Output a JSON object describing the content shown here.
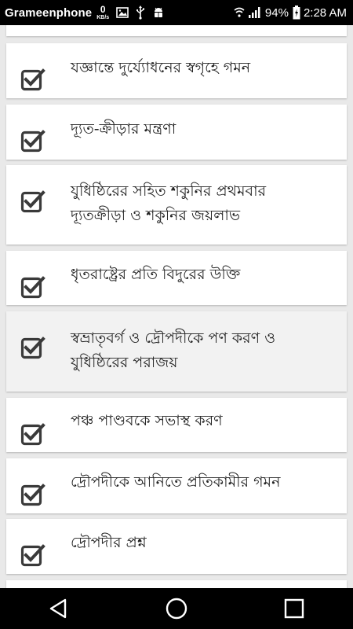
{
  "status_bar": {
    "carrier": "Grameenphone",
    "net_speed_value": "0",
    "net_speed_unit": "KB/s",
    "battery": "94%",
    "time": "2:28 AM"
  },
  "icons": {
    "image": "image-icon",
    "usb": "usb-icon",
    "debug": "android-debug-icon",
    "wifi": "wifi-icon",
    "signal": "signal-icon",
    "battery": "battery-icon",
    "check": "checkbox-checked-icon"
  },
  "items": [
    {
      "lines": [
        "যজ্ঞান্তে দুর্য্যোধনের স্বগৃহে গমন"
      ],
      "checked": true
    },
    {
      "lines": [
        "দ্যূত-ক্রীড়ার মন্ত্রণা"
      ],
      "checked": true
    },
    {
      "lines": [
        "যুধিষ্ঠিরের সহিত শকুনির প্রথমবার",
        "দ্যূতক্রীড়া ও শকুনির জয়লাভ"
      ],
      "checked": true
    },
    {
      "lines": [
        "ধৃতরাষ্ট্রের প্রতি বিদুরের উক্তি"
      ],
      "checked": true
    },
    {
      "lines": [
        "স্বভ্রাতৃবর্গ ও দ্রৌপদীকে পণ করণ ও",
        "যুধিষ্ঠিরের পরাজয়"
      ],
      "checked": true
    },
    {
      "lines": [
        "পঞ্চ পাণ্ডবকে সভাস্থ করণ"
      ],
      "checked": true
    },
    {
      "lines": [
        "দ্রৌপদীকে আনিতে প্রতিকামীর গমন"
      ],
      "checked": true
    },
    {
      "lines": [
        "দ্রৌপদীর প্রশ্ন"
      ],
      "checked": true
    }
  ],
  "nav": {
    "back": "back-icon",
    "home": "home-icon",
    "recents": "recents-icon"
  },
  "colors": {
    "status_bar": "#000000",
    "background": "#e9e9e9",
    "card": "#ffffff",
    "card_selected": "#f2f2f2",
    "text": "#222222",
    "check": "#3a3a3a"
  }
}
